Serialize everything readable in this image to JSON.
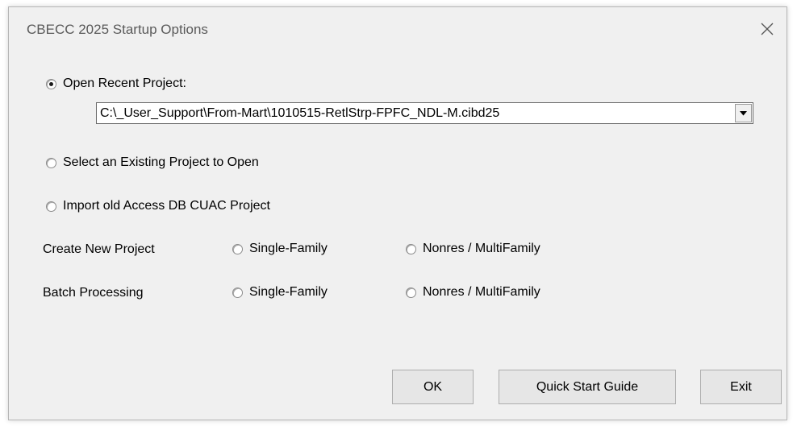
{
  "dialog": {
    "title": "CBECC 2025 Startup Options",
    "close_icon": "close-icon"
  },
  "options": {
    "open_recent": {
      "label": "Open Recent Project:",
      "checked": true
    },
    "recent_project_path": "C:\\_User_Support\\From-Mart\\1010515-RetlStrp-FPFC_NDL-M.cibd25",
    "select_existing": {
      "label": "Select an Existing Project to Open",
      "checked": false
    },
    "import_access": {
      "label": "Import old Access DB CUAC Project",
      "checked": false
    }
  },
  "create_new": {
    "label": "Create New Project",
    "single_family": "Single-Family",
    "nonres_multifamily": "Nonres / MultiFamily"
  },
  "batch": {
    "label": "Batch Processing",
    "single_family": "Single-Family",
    "nonres_multifamily": "Nonres / MultiFamily"
  },
  "buttons": {
    "ok": "OK",
    "quick_start": "Quick Start Guide",
    "exit": "Exit"
  }
}
